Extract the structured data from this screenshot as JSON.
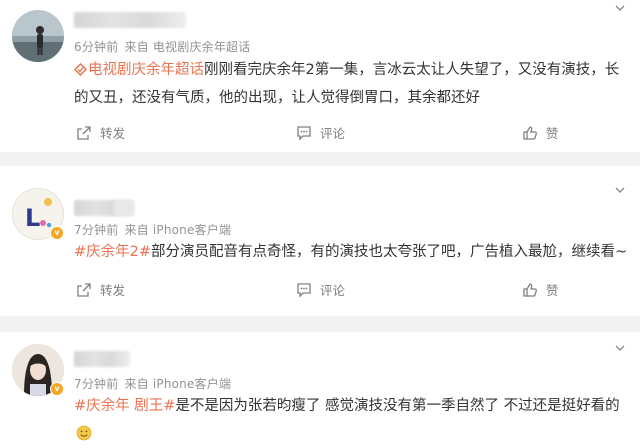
{
  "posts": [
    {
      "time": "6分钟前",
      "source": "来自 电视剧庆余年超话",
      "topic": "电视剧庆余年超话",
      "text": "刚刚看完庆余年2第一集，言冰云太让人失望了，又没有演技，长的又丑，还没有气质，他的出现，让人觉得倒胃口，其余都还好",
      "actions": {
        "share": "转发",
        "comment": "评论",
        "like": "赞"
      }
    },
    {
      "time": "7分钟前",
      "source": "来自 iPhone客户端",
      "topic": "#庆余年2#",
      "text": "部分演员配音有点奇怪，有的演技也太夸张了吧，广告植入最尬，继续看~",
      "actions": {
        "share": "转发",
        "comment": "评论",
        "like": "赞"
      }
    },
    {
      "time": "7分钟前",
      "source": "来自 iPhone客户端",
      "topic": "#庆余年 剧王#",
      "text": "是不是因为张若昀瘦了 感觉演技没有第一季自然了 不过还是挺好看的"
    }
  ],
  "icons": {
    "topic": "super-topic-icon",
    "share": "share-icon",
    "comment": "comment-icon",
    "like": "thumbs-up-icon",
    "more": "chevron-down-icon",
    "emoji": "smile-emoji-icon",
    "verified": "verified-badge-icon"
  },
  "colors": {
    "topic": "#eb7350",
    "text": "#333333",
    "meta": "#939393",
    "divider": "#f2f2f2",
    "badge": "#f6a623"
  }
}
